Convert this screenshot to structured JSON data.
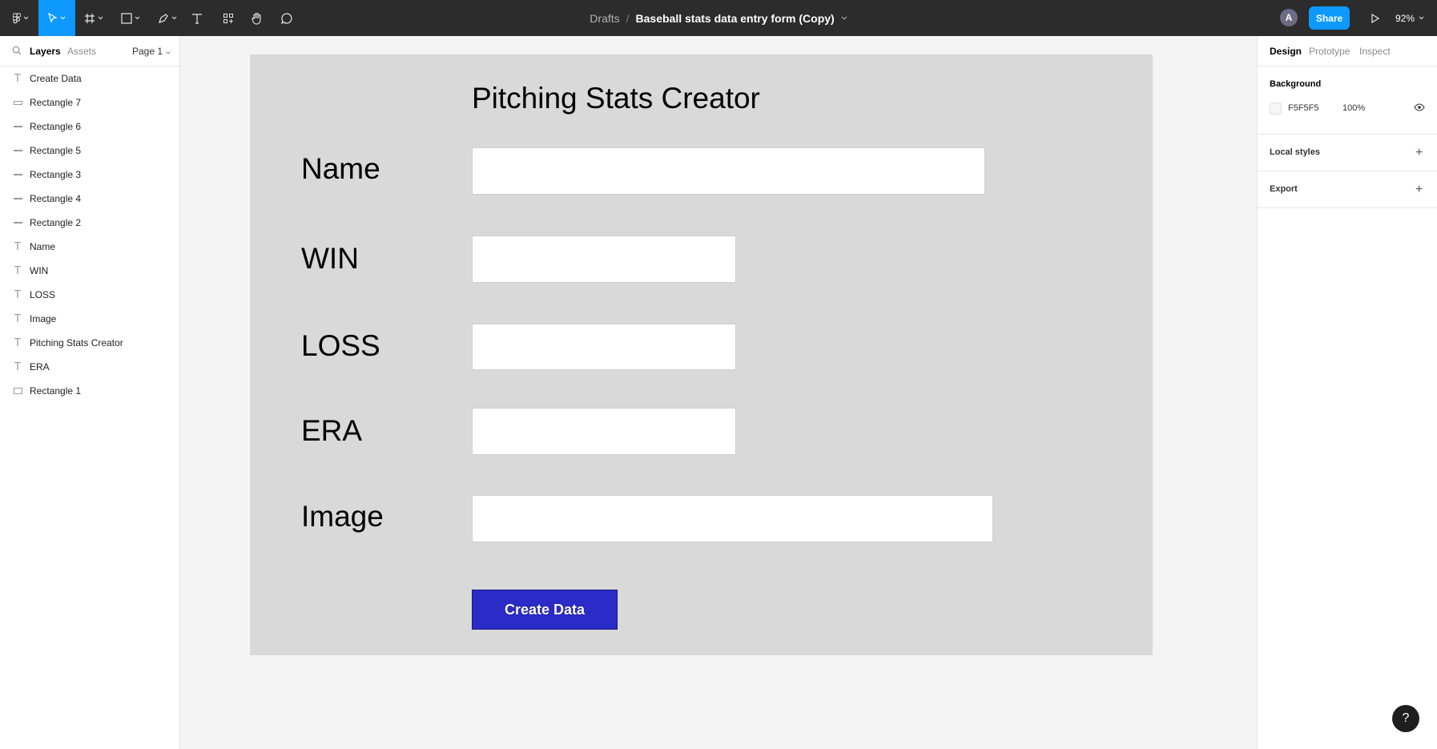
{
  "topbar": {
    "breadcrumb_drafts": "Drafts",
    "breadcrumb_separator": "/",
    "file_title": "Baseball stats data entry form (Copy)",
    "avatar_initial": "A",
    "share_label": "Share",
    "zoom_label": "92%",
    "active_tool": "move",
    "accent_color": "#0d99ff"
  },
  "left_panel": {
    "tab_layers": "Layers",
    "tab_assets": "Assets",
    "page_label": "Page 1",
    "layers": [
      {
        "label": "Create Data",
        "icon": "text-icon"
      },
      {
        "label": "Rectangle 7",
        "icon": "rectangle-icon"
      },
      {
        "label": "Rectangle 6",
        "icon": "line-icon"
      },
      {
        "label": "Rectangle 5",
        "icon": "line-icon"
      },
      {
        "label": "Rectangle 3",
        "icon": "line-icon"
      },
      {
        "label": "Rectangle 4",
        "icon": "line-icon"
      },
      {
        "label": "Rectangle 2",
        "icon": "line-icon"
      },
      {
        "label": "Name",
        "icon": "text-icon"
      },
      {
        "label": "WIN",
        "icon": "text-icon"
      },
      {
        "label": "LOSS",
        "icon": "text-icon"
      },
      {
        "label": "Image",
        "icon": "text-icon"
      },
      {
        "label": "Pitching Stats Creator",
        "icon": "text-icon"
      },
      {
        "label": "ERA",
        "icon": "text-icon"
      },
      {
        "label": "Rectangle 1",
        "icon": "rectangle-icon"
      }
    ]
  },
  "right_panel": {
    "tab_design": "Design",
    "tab_prototype": "Prototype",
    "tab_inspect": "Inspect",
    "background_heading": "Background",
    "background_hex": "F5F5F5",
    "background_opacity": "100%",
    "local_styles_heading": "Local styles",
    "export_heading": "Export"
  },
  "form": {
    "title": "Pitching Stats Creator",
    "label_name": "Name",
    "label_win": "WIN",
    "label_loss": "LOSS",
    "label_era": "ERA",
    "label_image": "Image",
    "button_label": "Create Data",
    "frame_color": "#d9d9d9",
    "button_color": "#2b2bc8"
  },
  "help_label": "?"
}
